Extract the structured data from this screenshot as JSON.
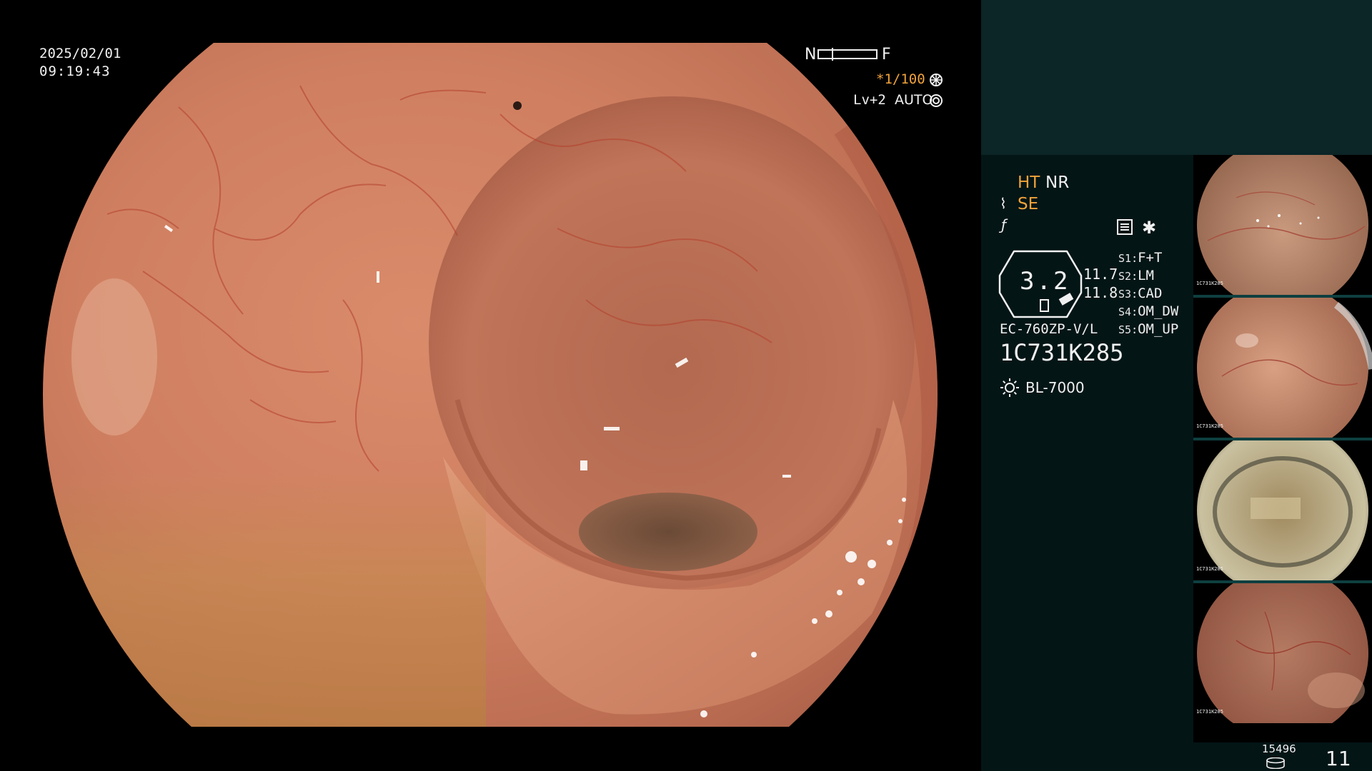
{
  "overlay": {
    "date": "2025/02/01",
    "time": "09:19:43",
    "focus_near": "N",
    "focus_far": "F",
    "shutter": "*1/100",
    "shutter_icon": "aperture-icon",
    "enhancement": "Lv+2",
    "iris_mode": "AUTO",
    "iris_icon": "iris-icon"
  },
  "panel": {
    "ht_label": "HT",
    "nr_label": "NR",
    "se_label": "SE",
    "zoom_value": "3.2",
    "value_a": "11.7",
    "value_b": "11.8",
    "scope_model": "EC-760ZP-V/L",
    "scope_serial": "1C731K285",
    "light_source": "BL-7000",
    "switches": [
      {
        "key": "S1",
        "value": "F+T"
      },
      {
        "key": "S2",
        "value": "LM"
      },
      {
        "key": "S3",
        "value": "CAD"
      },
      {
        "key": "S4",
        "value": "OM_DW"
      },
      {
        "key": "S5",
        "value": "OM_UP"
      }
    ],
    "storage_count": "15496",
    "capture_count": "11"
  },
  "thumbnails": [
    {
      "serial": "1C731K285"
    },
    {
      "serial": "1C731K285"
    },
    {
      "serial": "1C731K285"
    },
    {
      "serial": "1C731K285"
    }
  ],
  "colors": {
    "accent_orange": "#f1a33a",
    "panel_bg": "#041516",
    "panel_top_bg": "#0c2526",
    "thumb_separator": "#0e3f40"
  }
}
